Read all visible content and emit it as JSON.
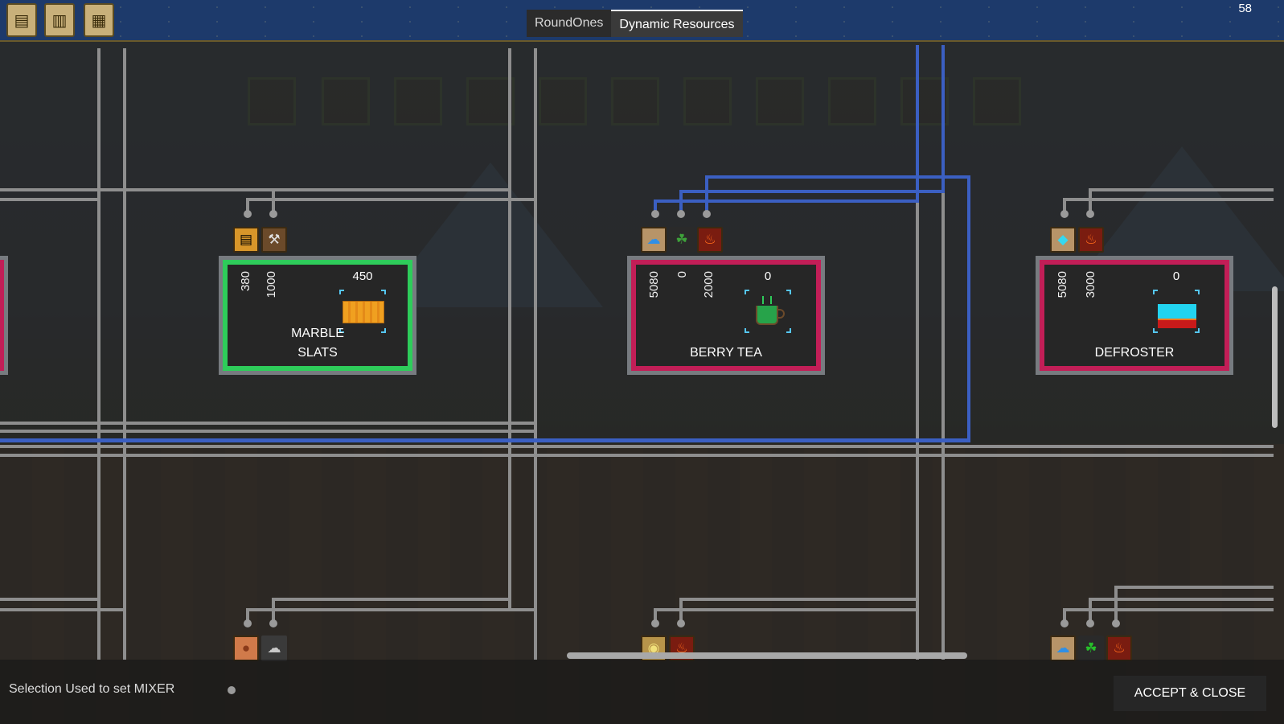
{
  "window": {
    "frame_counter": "58"
  },
  "tabs": [
    {
      "label": "RoundOnes",
      "active": false
    },
    {
      "label": "Dynamic Resources",
      "active": true
    }
  ],
  "toolbar": {
    "book_icons": [
      "book-icon",
      "open-book-icon",
      "ledger-icon"
    ]
  },
  "builds": [
    {
      "name_line1": "MARBLE",
      "name_line2": "SLATS",
      "status": "configured",
      "border_color": "#2ecc5a",
      "input_amounts": [
        "380",
        "1000"
      ],
      "output_amount": "450",
      "input_icons": [
        "marble-icon",
        "tools-icon"
      ],
      "product_icon": "marble-slats-icon"
    },
    {
      "name_line1": "BERRY TEA",
      "name_line2": "",
      "status": "needs-config",
      "border_color": "#c21e57",
      "input_amounts": [
        "5080",
        "0",
        "2000"
      ],
      "output_amount": "0",
      "input_icons": [
        "water-icon",
        "berries-icon",
        "fire-icon"
      ],
      "product_icon": "tea-cup-icon"
    },
    {
      "name_line1": "DEFROSTER",
      "name_line2": "",
      "status": "needs-config",
      "border_color": "#c21e57",
      "input_amounts": [
        "5080",
        "3000"
      ],
      "output_amount": "0",
      "input_icons": [
        "ice-icon",
        "fire-icon"
      ],
      "product_icon": "defroster-icon"
    }
  ],
  "lower_row_inputs": [
    [
      "clay-icon",
      "stone-icon"
    ],
    [
      "eggs-icon",
      "fire-icon"
    ],
    [
      "water-icon",
      "berries-icon",
      "fire-icon"
    ]
  ],
  "bottom": {
    "selection_text": "Selection Used to set MIXER",
    "accept_label": "ACCEPT & CLOSE"
  },
  "colors": {
    "wire_gray": "#8e8e8e",
    "wire_blue": "#3b5fc2",
    "configured": "#2ecc5a",
    "needs_config": "#c21e57"
  }
}
